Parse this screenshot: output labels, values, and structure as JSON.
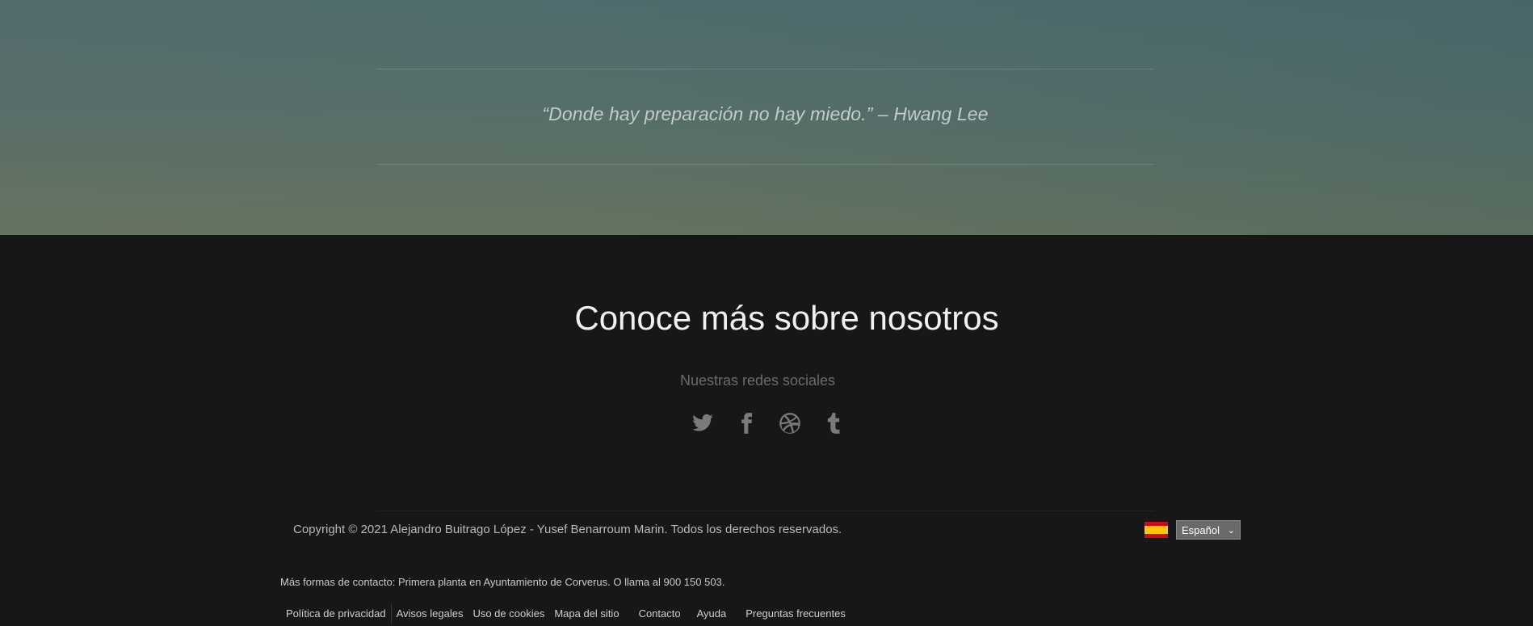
{
  "hero": {
    "quote": "“Donde hay preparación no hay miedo.” – Hwang Lee"
  },
  "footer": {
    "title": "Conoce más sobre nosotros",
    "social_label": "Nuestras redes sociales",
    "social_icons": [
      "twitter-icon",
      "facebook-icon",
      "dribbble-icon",
      "tumblr-icon"
    ],
    "copyright": "Copyright © 2021 Alejandro Buitrago López - Yusef Benarroum Marin. Todos los derechos reservados.",
    "language": {
      "flag": "spain-flag-icon",
      "selected": "Español"
    },
    "contact": "Más formas de contacto: Primera planta en Ayuntamiento de Corverus. O llama al 900 150 503.",
    "links": [
      "Política de privacidad",
      "Avisos legales",
      "Uso de cookies",
      "Mapa del sitio",
      "Contacto",
      "Ayuda",
      "Preguntas frecuentes"
    ]
  },
  "colors": {
    "footer_bg": "#171717",
    "hero_top": "#4f6b6d",
    "hero_bottom": "#65735f"
  }
}
